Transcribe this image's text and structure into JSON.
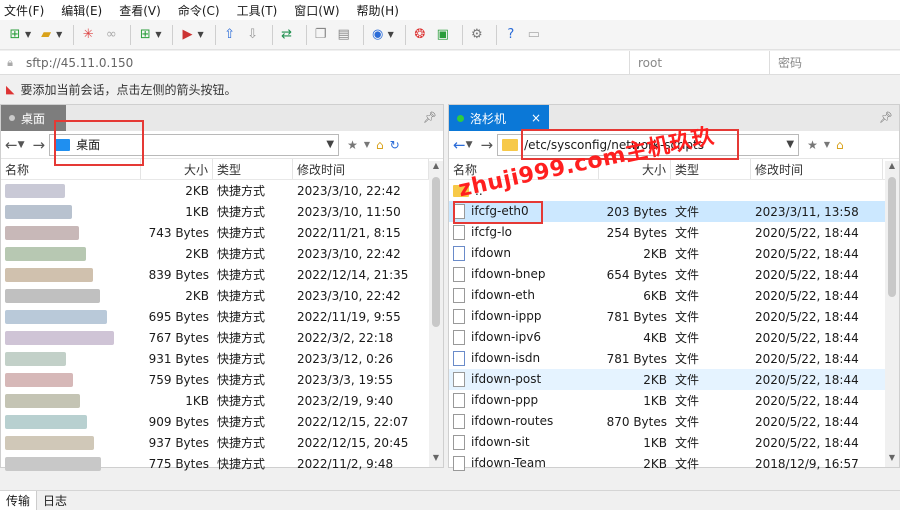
{
  "menu": [
    "文件(F)",
    "编辑(E)",
    "查看(V)",
    "命令(C)",
    "工具(T)",
    "窗口(W)",
    "帮助(H)"
  ],
  "address": {
    "host": "sftp://45.11.0.150",
    "user": "root",
    "password_placeholder": "密码"
  },
  "hint": "要添加当前会话，点击左侧的箭头按钮。",
  "left": {
    "tab": "桌面",
    "path": "桌面",
    "columns": [
      "名称",
      "大小",
      "类型",
      "修改时间"
    ],
    "rows": [
      {
        "name": "",
        "size": "2KB",
        "type": "快捷方式",
        "modified": "2023/3/10, 22:42"
      },
      {
        "name": "",
        "size": "1KB",
        "type": "快捷方式",
        "modified": "2023/3/10, 11:50"
      },
      {
        "name": "",
        "size": "743 Bytes",
        "type": "快捷方式",
        "modified": "2022/11/21, 8:15"
      },
      {
        "name": "",
        "size": "2KB",
        "type": "快捷方式",
        "modified": "2023/3/10, 22:42"
      },
      {
        "name": "",
        "size": "839 Bytes",
        "type": "快捷方式",
        "modified": "2022/12/14, 21:35"
      },
      {
        "name": "",
        "size": "2KB",
        "type": "快捷方式",
        "modified": "2023/3/10, 22:42"
      },
      {
        "name": "",
        "size": "695 Bytes",
        "type": "快捷方式",
        "modified": "2022/11/19, 9:55"
      },
      {
        "name": "",
        "size": "767 Bytes",
        "type": "快捷方式",
        "modified": "2022/3/2, 22:18"
      },
      {
        "name": "",
        "size": "931 Bytes",
        "type": "快捷方式",
        "modified": "2023/3/12, 0:26"
      },
      {
        "name": "",
        "size": "759 Bytes",
        "type": "快捷方式",
        "modified": "2023/3/3, 19:55"
      },
      {
        "name": "",
        "size": "1KB",
        "type": "快捷方式",
        "modified": "2023/2/19, 9:40"
      },
      {
        "name": "",
        "size": "909 Bytes",
        "type": "快捷方式",
        "modified": "2022/12/15, 22:07"
      },
      {
        "name": "",
        "size": "937 Bytes",
        "type": "快捷方式",
        "modified": "2022/12/15, 20:45"
      },
      {
        "name": "",
        "size": "775 Bytes",
        "type": "快捷方式",
        "modified": "2022/11/2, 9:48"
      }
    ]
  },
  "right": {
    "tab": "洛杉机",
    "tab_close": "×",
    "path": "/etc/sysconfig/network-scripts",
    "columns": [
      "名称",
      "大小",
      "类型",
      "修改时间"
    ],
    "rows": [
      {
        "name": "..",
        "size": "",
        "type": "",
        "modified": "",
        "icon": "folder"
      },
      {
        "name": "ifcfg-eth0",
        "size": "203 Bytes",
        "type": "文件",
        "modified": "2023/3/11, 13:58",
        "icon": "file"
      },
      {
        "name": "ifcfg-lo",
        "size": "254 Bytes",
        "type": "文件",
        "modified": "2020/5/22, 18:44",
        "icon": "file"
      },
      {
        "name": "ifdown",
        "size": "2KB",
        "type": "文件",
        "modified": "2020/5/22, 18:44",
        "icon": "link"
      },
      {
        "name": "ifdown-bnep",
        "size": "654 Bytes",
        "type": "文件",
        "modified": "2020/5/22, 18:44",
        "icon": "file"
      },
      {
        "name": "ifdown-eth",
        "size": "6KB",
        "type": "文件",
        "modified": "2020/5/22, 18:44",
        "icon": "file"
      },
      {
        "name": "ifdown-ippp",
        "size": "781 Bytes",
        "type": "文件",
        "modified": "2020/5/22, 18:44",
        "icon": "file"
      },
      {
        "name": "ifdown-ipv6",
        "size": "4KB",
        "type": "文件",
        "modified": "2020/5/22, 18:44",
        "icon": "file"
      },
      {
        "name": "ifdown-isdn",
        "size": "781 Bytes",
        "type": "文件",
        "modified": "2020/5/22, 18:44",
        "icon": "link"
      },
      {
        "name": "ifdown-post",
        "size": "2KB",
        "type": "文件",
        "modified": "2020/5/22, 18:44",
        "icon": "file"
      },
      {
        "name": "ifdown-ppp",
        "size": "1KB",
        "type": "文件",
        "modified": "2020/5/22, 18:44",
        "icon": "file"
      },
      {
        "name": "ifdown-routes",
        "size": "870 Bytes",
        "type": "文件",
        "modified": "2020/5/22, 18:44",
        "icon": "file"
      },
      {
        "name": "ifdown-sit",
        "size": "1KB",
        "type": "文件",
        "modified": "2020/5/22, 18:44",
        "icon": "file"
      },
      {
        "name": "ifdown-Team",
        "size": "2KB",
        "type": "文件",
        "modified": "2018/12/9, 16:57",
        "icon": "file"
      }
    ]
  },
  "watermark": "zhuji999.com主机玖玖",
  "bottom_tabs": [
    "传输",
    "日志"
  ],
  "colors": {
    "accent": "#0b78d7",
    "selection": "#cce8ff",
    "highlight_box": "#e53935"
  },
  "icons": [
    "new-session-icon",
    "open-folder-icon",
    "disconnect-icon",
    "reconnect-icon",
    "new-tab-icon",
    "run-icon",
    "upload-icon",
    "download-icon",
    "sync-icon",
    "copy-icon",
    "paste-icon",
    "globe-icon",
    "xshell-icon",
    "xftp-icon",
    "gear-icon",
    "help-icon",
    "chat-icon"
  ]
}
